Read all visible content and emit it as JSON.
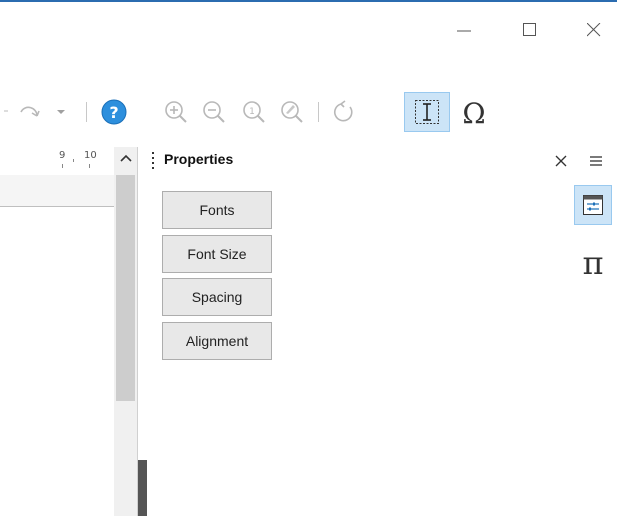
{
  "window": {
    "controls": [
      {
        "name": "minimize",
        "icon": "minimize-icon"
      },
      {
        "name": "maximize",
        "icon": "maximize-icon"
      },
      {
        "name": "close",
        "icon": "close-icon"
      }
    ]
  },
  "toolbar": {
    "buttons": [
      {
        "icon": "redo-icon",
        "enabled": false
      },
      {
        "icon": "redo-dropdown-icon",
        "enabled": false
      },
      {
        "icon": "help-icon",
        "enabled": true
      },
      {
        "icon": "zoom-in-icon",
        "enabled": false
      },
      {
        "icon": "zoom-out-icon",
        "enabled": false
      },
      {
        "icon": "zoom-100-icon",
        "enabled": false
      },
      {
        "icon": "zoom-tool-icon",
        "enabled": false
      },
      {
        "icon": "rotate-icon",
        "enabled": false
      },
      {
        "icon": "text-cursor-icon",
        "enabled": true,
        "active": true
      },
      {
        "icon": "omega-special-character-icon",
        "enabled": true
      }
    ]
  },
  "ruler": {
    "labels": [
      "9",
      "10"
    ]
  },
  "sidebar": {
    "title": "Properties",
    "buttons": [
      "Fonts",
      "Font Size",
      "Spacing",
      "Alignment"
    ],
    "close_icon": "close-icon",
    "menu_icon": "hamburger-menu-icon"
  },
  "tabbar": {
    "items": [
      {
        "icon": "properties-icon",
        "active": true
      },
      {
        "icon": "pi-elements-icon",
        "active": false
      }
    ]
  },
  "colors": {
    "accent": "#2b6cb0",
    "active_bg": "#cce4f7",
    "active_border": "#99c9ef",
    "help_blue": "#2d8fdd"
  }
}
